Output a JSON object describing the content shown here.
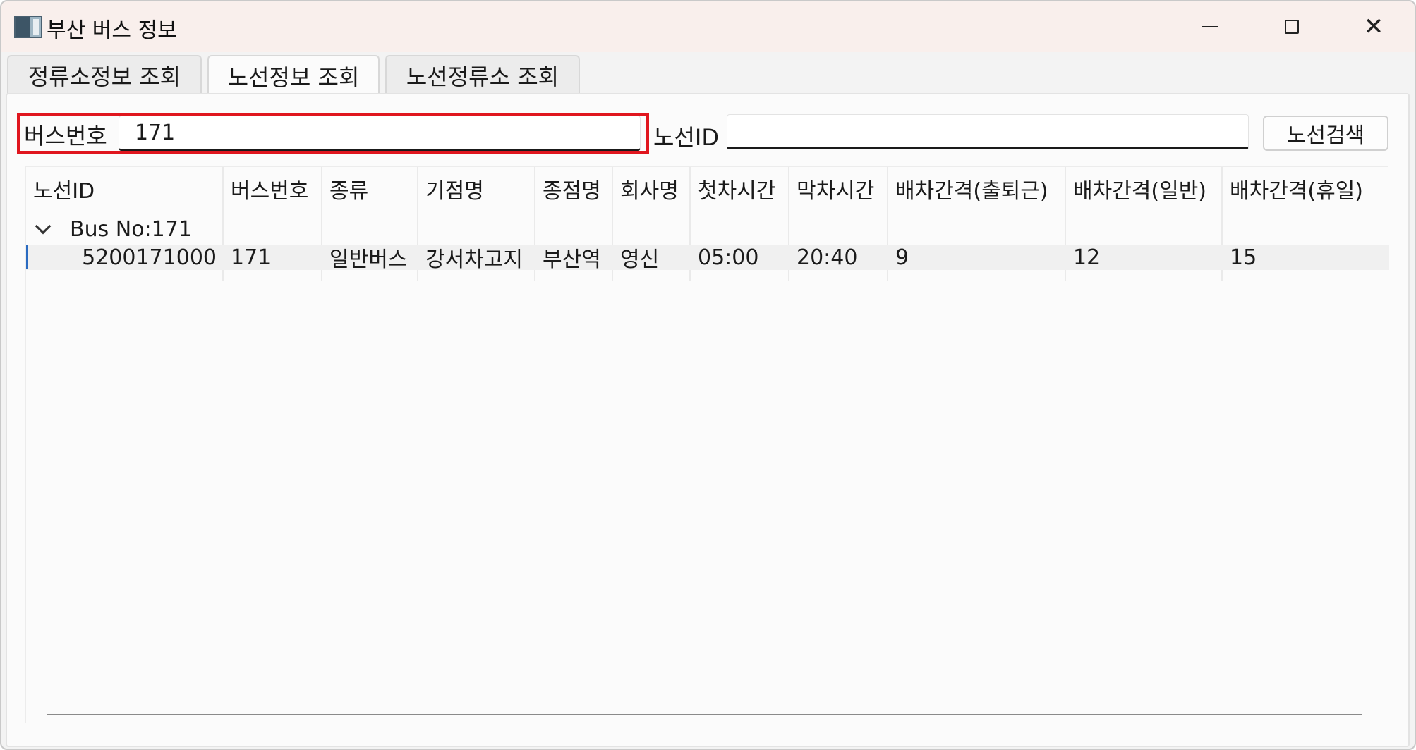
{
  "window": {
    "title": "부산 버스 정보",
    "icon": "window-app-icon",
    "controls": [
      "minimize-icon",
      "maximize-icon",
      "close-icon"
    ],
    "close_glyph": "✕"
  },
  "tabs": [
    {
      "label": "정류소정보 조회",
      "active": false
    },
    {
      "label": "노선정보 조회",
      "active": true
    },
    {
      "label": "노선정류소 조회",
      "active": false
    }
  ],
  "search": {
    "bus_number_label": "버스번호",
    "bus_number_value": "171",
    "route_id_label": "노선ID",
    "route_id_value": "",
    "search_button": "노선검색",
    "highlight_color": "#e0161e"
  },
  "grid": {
    "columns": [
      "노선ID",
      "버스번호",
      "종류",
      "기점명",
      "종점명",
      "회사명",
      "첫차시간",
      "막차시간",
      "배차간격(출퇴근)",
      "배차간격(일반)",
      "배차간격(휴일)"
    ],
    "group": {
      "label": "Bus No:171",
      "expanded": true
    },
    "rows": [
      [
        "5200171000",
        "171",
        "일반버스",
        "강서차고지",
        "부산역",
        "영신",
        "05:00",
        "20:40",
        "9",
        "12",
        "15"
      ]
    ],
    "selection_color": "#2a6bc1"
  }
}
